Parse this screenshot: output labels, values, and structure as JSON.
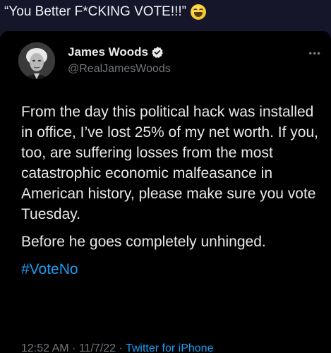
{
  "caption": {
    "text": "“You Better F*CKING VOTE!!!”",
    "emoji_icon": "grinning-face-icon"
  },
  "tweet": {
    "author_name": "James Woods",
    "handle": "@RealJamesWoods",
    "verified": true,
    "paragraph1": "From the day this political hack was installed in office, I’ve lost 25% of my net worth. If you, too, are suffering losses from the most catastrophic economic malfeasance in American history, please make sure you vote Tuesday.",
    "paragraph2": "Before he goes completely unhinged.",
    "hashtag": "#VoteNo",
    "time": "12:52 AM",
    "separator1": " · ",
    "date": "11/7/22",
    "separator2": " · ",
    "source": "Twitter for iPhone",
    "more_icon": "more-options-icon"
  },
  "colors": {
    "link": "#1d9bf0",
    "text": "#e7e9ea",
    "muted": "#71767b",
    "card_bg": "#000000",
    "page_bg": "#15162a"
  }
}
